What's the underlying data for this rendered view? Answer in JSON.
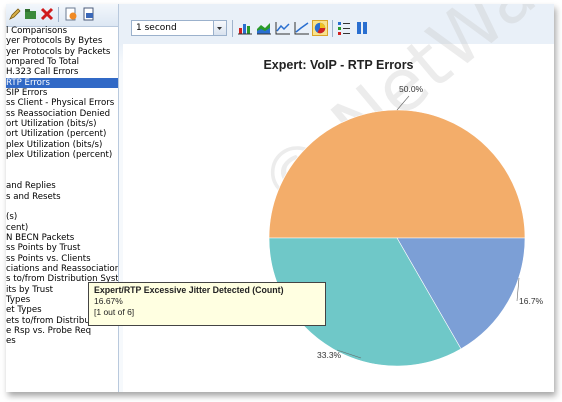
{
  "sidebar": {
    "items": [
      "l Comparisons",
      "yer Protocols By Bytes",
      "yer Protocols by Packets",
      "ompared To Total",
      "H.323 Call Errors",
      "RTP Errors",
      "SIP Errors",
      "ss Client - Physical Errors",
      "ss Reassociation Denied",
      "ort Utilization (bits/s)",
      "ort Utilization (percent)",
      "plex Utilization (bits/s)",
      "plex Utilization (percent)",
      "",
      "",
      "and Replies",
      "s and Resets",
      "",
      "(s)",
      "cent)",
      "N BECN Packets",
      "ss Points by Trust",
      "ss Points vs. Clients",
      "ciations and Reassociations",
      "s to/from Distribution Syste",
      "its by Trust",
      "Types",
      "et Types",
      "ets to/from Distribution Sys",
      "e Rsp vs. Probe Req",
      "es"
    ],
    "selected_index": 5
  },
  "toolbar": {
    "interval_value": "1 second"
  },
  "colors": {
    "slice_orange": "#f3ad6a",
    "slice_blue": "#7c9fd6",
    "slice_teal": "#6fc8c8",
    "selection": "#3169c6"
  },
  "chart_data": {
    "type": "pie",
    "title": "Expert: VoIP - RTP Errors",
    "slices": [
      {
        "label": "50.0%",
        "value": 3,
        "percent": 50.0,
        "color": "#f3ad6a"
      },
      {
        "label": "16.7%",
        "value": 1,
        "percent": 16.67,
        "color": "#7c9fd6"
      },
      {
        "label": "33.3%",
        "value": 2,
        "percent": 33.3,
        "color": "#6fc8c8"
      }
    ]
  },
  "tooltip": {
    "title": "Expert/RTP Excessive Jitter Detected (Count)",
    "percent": "16.67%",
    "count": "[1 out of 6]"
  },
  "watermark": "© NetWalker"
}
